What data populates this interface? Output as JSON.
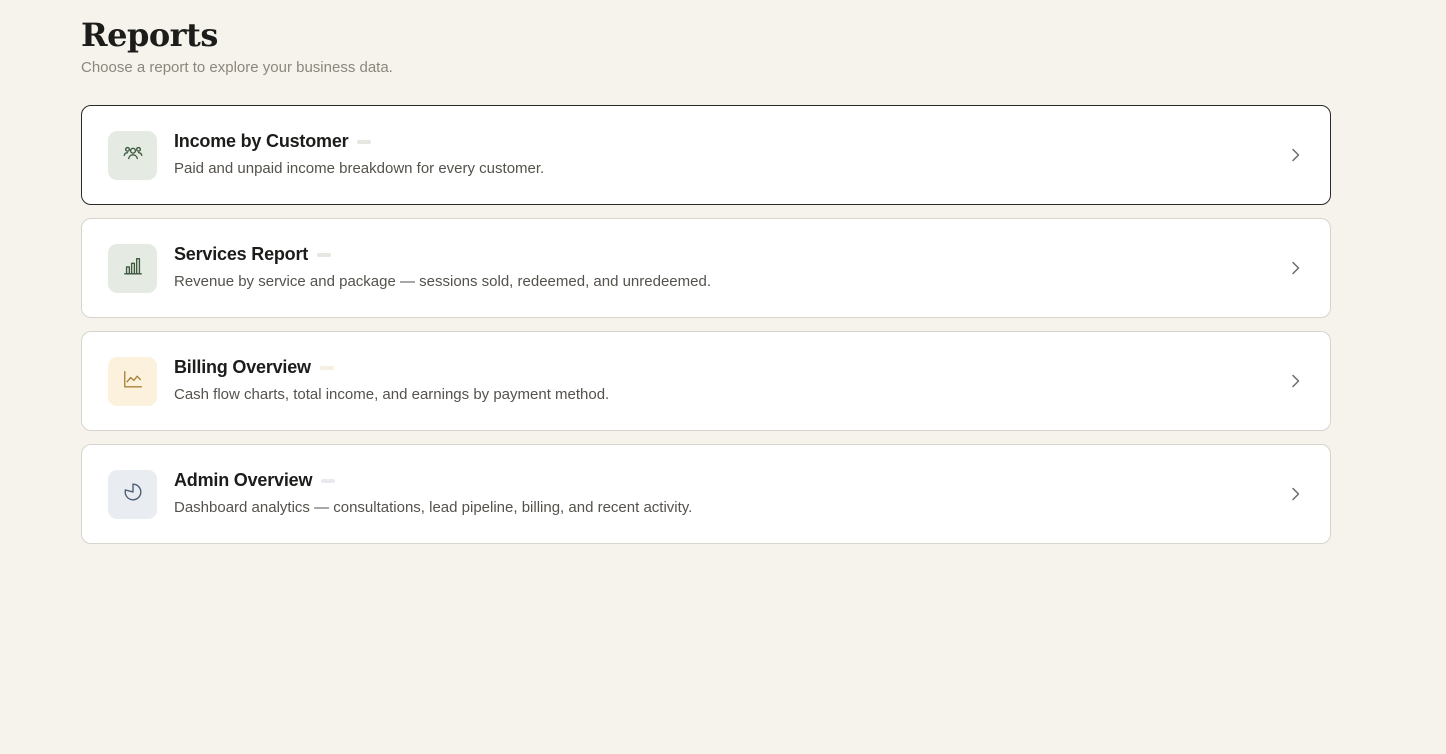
{
  "header": {
    "title": "Reports",
    "subtitle": "Choose a report to explore your business data."
  },
  "reports": [
    {
      "title": "Income by Customer",
      "description": "Paid and unpaid income breakdown for every customer.",
      "icon": "users-icon",
      "icon_bg": "#e5ebe3",
      "icon_color": "#3e5a3e",
      "pill_color": "#e8e6e0",
      "active": true
    },
    {
      "title": "Services Report",
      "description": "Revenue by service and package — sessions sold, redeemed, and unredeemed.",
      "icon": "bar-chart-icon",
      "icon_bg": "#e5ebe3",
      "icon_color": "#3e5a3e",
      "pill_color": "#e8e6e0",
      "active": false
    },
    {
      "title": "Billing Overview",
      "description": "Cash flow charts, total income, and earnings by payment method.",
      "icon": "line-chart-icon",
      "icon_bg": "#fbf1dc",
      "icon_color": "#a8843a",
      "pill_color": "#f6efdf",
      "active": false
    },
    {
      "title": "Admin Overview",
      "description": "Dashboard analytics — consultations, lead pipeline, billing, and recent activity.",
      "icon": "pie-chart-icon",
      "icon_bg": "#e9edf2",
      "icon_color": "#4c5d75",
      "pill_color": "#e8e9ec",
      "active": false
    }
  ],
  "colors": {
    "background": "#f6f3ec",
    "card_border": "#d7d4cd",
    "active_border": "#2a2a28",
    "chevron": "#6f6c66"
  }
}
